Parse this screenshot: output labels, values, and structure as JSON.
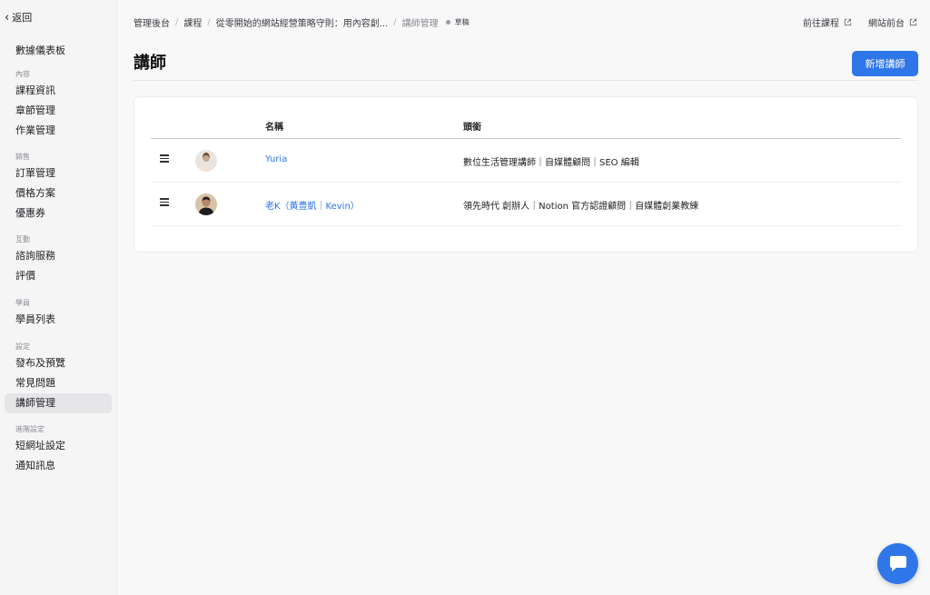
{
  "sidebar": {
    "back_label": "返回",
    "top_item": "數據儀表板",
    "groups": [
      {
        "title": "內容",
        "items": [
          "課程資訊",
          "章節管理",
          "作業管理"
        ]
      },
      {
        "title": "銷售",
        "items": [
          "訂單管理",
          "價格方案",
          "優惠券"
        ]
      },
      {
        "title": "互動",
        "items": [
          "諮詢服務",
          "評價"
        ]
      },
      {
        "title": "學員",
        "items": [
          "學員列表"
        ]
      },
      {
        "title": "設定",
        "items": [
          "發布及預覽",
          "常見問題",
          "講師管理"
        ]
      },
      {
        "title": "進階設定",
        "items": [
          "短網址設定",
          "通知訊息"
        ]
      }
    ],
    "active_item": "講師管理"
  },
  "breadcrumb": {
    "items": [
      "管理後台",
      "課程",
      "從零開始的網站經營策略守則：用內容創...",
      "講師管理"
    ],
    "status": "草稿"
  },
  "toplinks": {
    "course_link": "前往課程",
    "site_link": "網站前台"
  },
  "page": {
    "title": "講師",
    "add_button": "新增講師"
  },
  "table": {
    "columns": {
      "name": "名稱",
      "title": "頭銜"
    },
    "rows": [
      {
        "name": "Yuria",
        "title": "數位生活管理講師｜自媒體顧問｜SEO 編輯"
      },
      {
        "name": "老K（黃豊凱｜Kevin）",
        "title": "領先時代 創辦人｜Notion 官方認證顧問｜自媒體創業教練"
      }
    ]
  },
  "colors": {
    "accent": "#2f76e9",
    "sidebar_active_bg": "#e6e6e9"
  }
}
